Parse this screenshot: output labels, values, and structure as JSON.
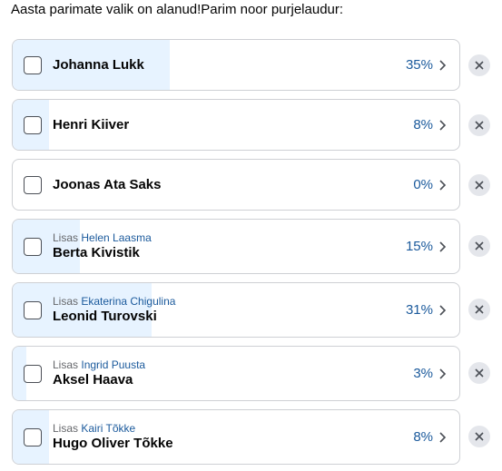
{
  "poll": {
    "question": "Aasta parimate valik on alanud!Parim noor purjelaudur:",
    "options": [
      {
        "name": "Johanna Lukk",
        "added_prefix": "",
        "added_by": "",
        "percent_label": "35%",
        "percent": 35
      },
      {
        "name": "Henri Kiiver",
        "added_prefix": "",
        "added_by": "",
        "percent_label": "8%",
        "percent": 8
      },
      {
        "name": "Joonas Ata Saks",
        "added_prefix": "",
        "added_by": "",
        "percent_label": "0%",
        "percent": 0
      },
      {
        "name": "Berta Kivistik",
        "added_prefix": "Lisas",
        "added_by": "Helen Laasma",
        "percent_label": "15%",
        "percent": 15
      },
      {
        "name": "Leonid Turovski",
        "added_prefix": "Lisas",
        "added_by": "Ekaterina Chigulina",
        "percent_label": "31%",
        "percent": 31
      },
      {
        "name": "Aksel Haava",
        "added_prefix": "Lisas",
        "added_by": "Ingrid Puusta",
        "percent_label": "3%",
        "percent": 3
      },
      {
        "name": "Hugo Oliver Tõkke",
        "added_prefix": "Lisas",
        "added_by": "Kairi Tõkke",
        "percent_label": "8%",
        "percent": 8
      }
    ]
  },
  "colors": {
    "fill": "#e7f3ff",
    "accent": "#1b5a9c",
    "border": "#ced0d4",
    "remove_bg": "#e4e6eb"
  },
  "icons": {
    "chevron": "chevron-right-icon",
    "remove": "close-icon"
  }
}
